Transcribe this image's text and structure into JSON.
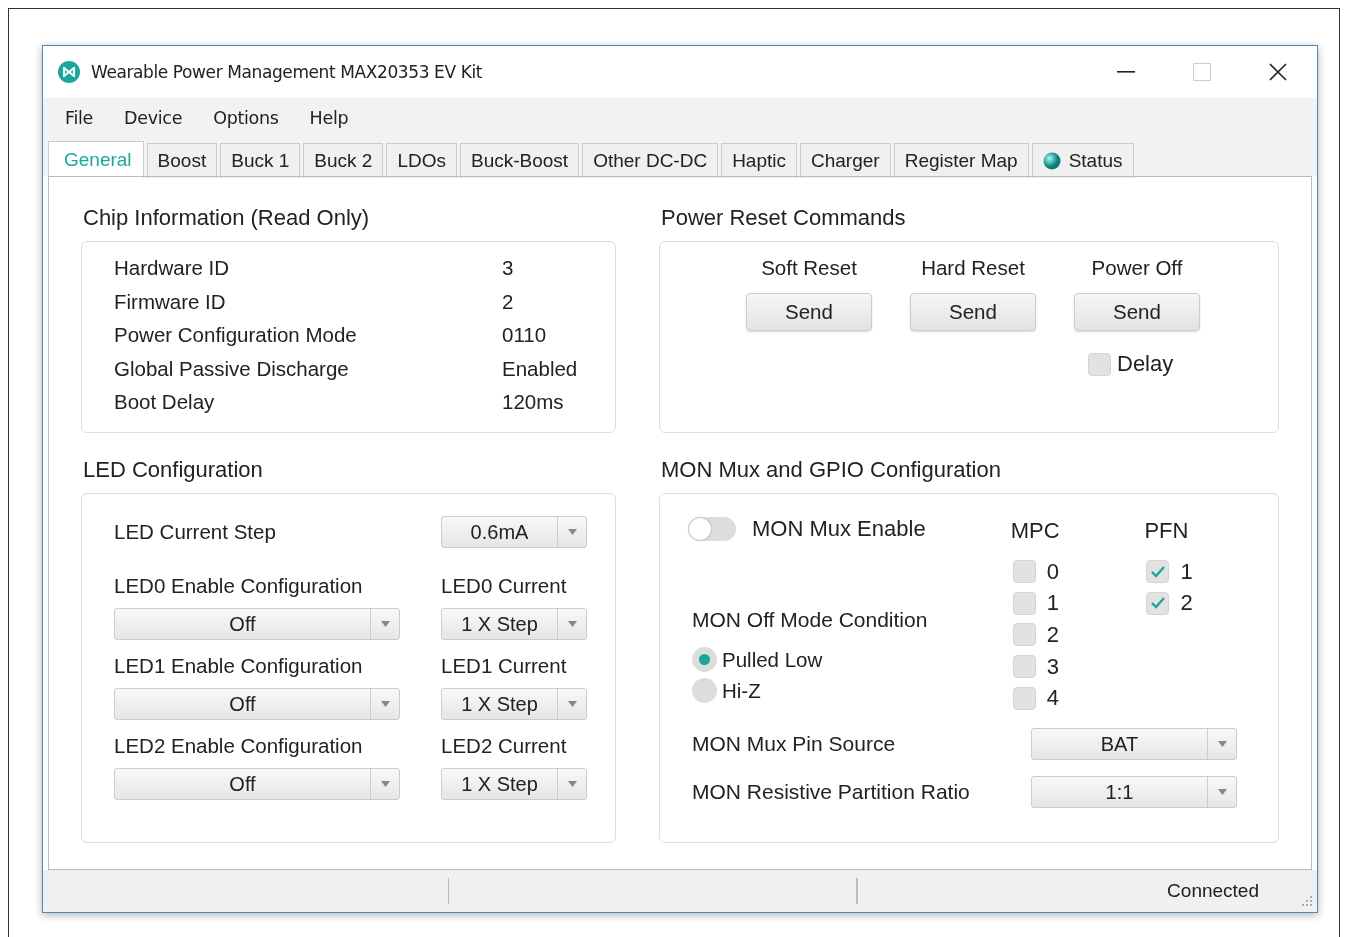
{
  "window": {
    "title": "Wearable Power Management MAX20353 EV Kit"
  },
  "menu": [
    "File",
    "Device",
    "Options",
    "Help"
  ],
  "tabs": [
    {
      "label": "General",
      "selected": true,
      "kind": "plain"
    },
    {
      "label": "Boost",
      "selected": false,
      "kind": "plain"
    },
    {
      "label": "Buck 1",
      "selected": false,
      "kind": "plain"
    },
    {
      "label": "Buck 2",
      "selected": false,
      "kind": "plain"
    },
    {
      "label": "LDOs",
      "selected": false,
      "kind": "plain"
    },
    {
      "label": "Buck-Boost",
      "selected": false,
      "kind": "plain"
    },
    {
      "label": "Other DC-DC",
      "selected": false,
      "kind": "plain"
    },
    {
      "label": "Haptic",
      "selected": false,
      "kind": "plain"
    },
    {
      "label": "Charger",
      "selected": false,
      "kind": "plain"
    },
    {
      "label": "Register Map",
      "selected": false,
      "kind": "plain"
    },
    {
      "label": "Status",
      "selected": false,
      "kind": "status"
    }
  ],
  "chip_info": {
    "title": "Chip Information (Read Only)",
    "rows": [
      {
        "label": "Hardware ID",
        "value": "3"
      },
      {
        "label": "Firmware ID",
        "value": "2"
      },
      {
        "label": "Power Configuration Mode",
        "value": "0110"
      },
      {
        "label": "Global Passive Discharge",
        "value": "Enabled"
      },
      {
        "label": "Boot Delay",
        "value": "120ms"
      }
    ]
  },
  "power_reset": {
    "title": "Power Reset Commands",
    "commands": [
      {
        "label": "Soft Reset",
        "button": "Send"
      },
      {
        "label": "Hard Reset",
        "button": "Send"
      },
      {
        "label": "Power Off",
        "button": "Send"
      }
    ],
    "delay": {
      "label": "Delay",
      "checked": false
    }
  },
  "led_config": {
    "title": "LED Configuration",
    "current_step": {
      "label": "LED Current Step",
      "value": "0.6mA"
    },
    "channels": [
      {
        "enable_label": "LED0 Enable Configuration",
        "enable_value": "Off",
        "current_label": "LED0 Current",
        "current_value": "1 X Step"
      },
      {
        "enable_label": "LED1 Enable Configuration",
        "enable_value": "Off",
        "current_label": "LED1 Current",
        "current_value": "1 X Step"
      },
      {
        "enable_label": "LED2 Enable Configuration",
        "enable_value": "Off",
        "current_label": "LED2 Current",
        "current_value": "1 X Step"
      }
    ]
  },
  "mon_mux": {
    "title": "MON Mux and GPIO Configuration",
    "enable": {
      "label": "MON Mux Enable",
      "on": false
    },
    "mpc": {
      "title": "MPC",
      "items": [
        {
          "label": "0",
          "checked": false
        },
        {
          "label": "1",
          "checked": false
        },
        {
          "label": "2",
          "checked": false
        },
        {
          "label": "3",
          "checked": false
        },
        {
          "label": "4",
          "checked": false
        }
      ]
    },
    "pfn": {
      "title": "PFN",
      "items": [
        {
          "label": "1",
          "checked": true
        },
        {
          "label": "2",
          "checked": true
        }
      ]
    },
    "off_mode": {
      "title": "MON Off Mode Condition",
      "options": [
        {
          "label": "Pulled Low",
          "selected": true
        },
        {
          "label": "Hi-Z",
          "selected": false
        }
      ]
    },
    "pin_source": {
      "label": "MON Mux Pin Source",
      "value": "BAT"
    },
    "ratio": {
      "label": "MON Resistive Partition Ratio",
      "value": "1:1"
    }
  },
  "status_bar": {
    "text": "Connected"
  }
}
